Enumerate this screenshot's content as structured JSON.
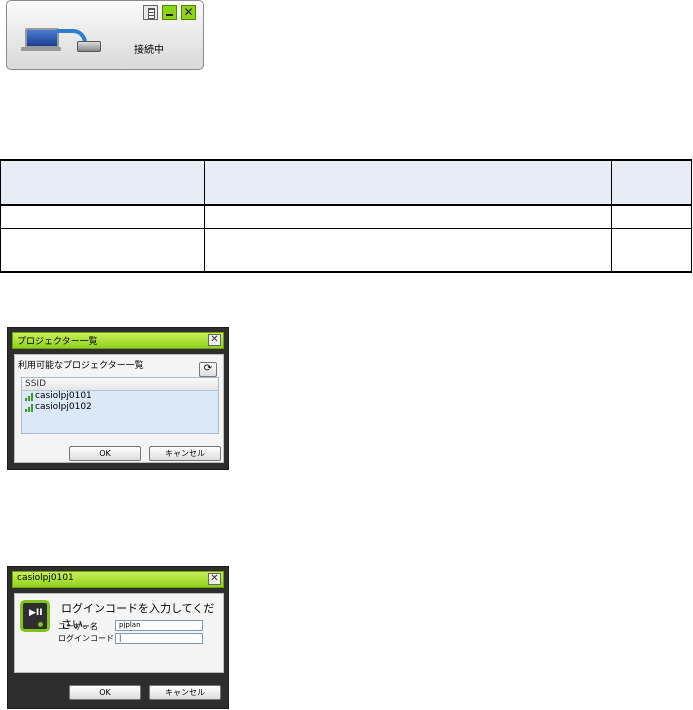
{
  "connection_widget": {
    "status": "接続中",
    "close_glyph": "✕",
    "icons": [
      "laptop-icon",
      "connection-arrow-icon",
      "projector-icon",
      "info-icon",
      "minimize-icon",
      "close-icon"
    ]
  },
  "table": {
    "headers": [
      "",
      "",
      ""
    ],
    "rows": [
      [
        "",
        "",
        ""
      ],
      [
        "",
        "",
        ""
      ]
    ]
  },
  "projector_dialog": {
    "title": "プロジェクター一覧",
    "subtitle": "利用可能なプロジェクター一覧",
    "list_header": "SSID",
    "items": [
      "casiolpj0101",
      "casiolpj0102"
    ],
    "ok_label": "OK",
    "cancel_label": "キャンセル",
    "close_glyph": "✕",
    "refresh_glyph": "⟳",
    "accent": "#8fd21a"
  },
  "login_dialog": {
    "title": "casiolpj0101",
    "prompt": "ログインコードを入力してください。",
    "username_label": "ユーザー名",
    "username_value": "pjplan",
    "login_label": "ログインコード",
    "login_value": "|",
    "ok_label": "OK",
    "cancel_label": "キャンセル",
    "close_glyph": "✕",
    "icon_glyph": "▶II"
  }
}
